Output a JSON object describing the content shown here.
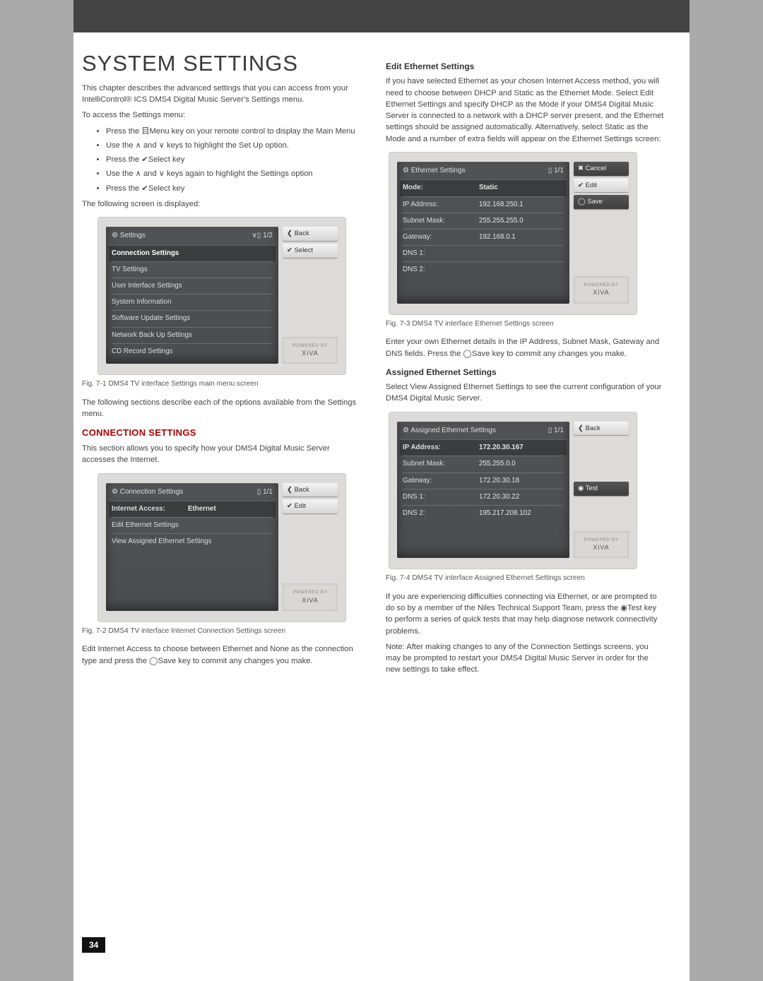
{
  "page": {
    "title": "SYSTEM SETTINGS",
    "intro": "This chapter describes the advanced settings that you can access from your IntelliControl® ICS DMS4 Digital Music Server's Settings menu.",
    "access_lead": "To access the Settings menu:",
    "steps": [
      "Press the 目Menu key on your remote control to display the Main Menu",
      "Use the ∧ and ∨ keys to highlight the Set Up option.",
      "Press the ✔Select key",
      "Use the ∧ and ∨ keys again to highlight the Settings option",
      "Press the ✔Select key"
    ],
    "post_steps": "The following screen is displayed:",
    "fig71_caption": "Fig. 7-1  DMS4 TV interface Settings main menu screen",
    "post_fig71": "The following sections describe each of the options available from the Settings menu.",
    "conn_heading": "CONNECTION SETTINGS",
    "conn_intro": "This section allows you to specify how your DMS4 Digital Music Server accesses the Internet.",
    "fig72_caption": "Fig. 7-2  DMS4 TV interface Internet Connection Settings screen",
    "conn_edit": "Edit Internet Access to choose between Ethernet and None as the connection type and press the ◯Save key to commit any changes you make.",
    "edit_eth_head": "Edit Ethernet Settings",
    "edit_eth_body": "If you have selected Ethernet as your chosen Internet Access method, you will need to choose between DHCP and Static as the Ethernet Mode.  Select Edit Ethernet Settings and specify DHCP as the Mode if your DMS4 Digital Music Server is connected to a network with a DHCP server present, and the Ethernet settings should be assigned automatically.  Alternatively, select Static as the Mode and a number of extra fields will appear on the Ethernet Settings screen:",
    "fig73_caption": "Fig. 7-3  DMS4 TV interface Ethernet Settings screen",
    "post_fig73": "Enter your own Ethernet details in the IP Address, Subnet Mask, Gateway and DNS fields.  Press the ◯Save key to commit any changes you make.",
    "assigned_head": "Assigned Ethernet Settings",
    "assigned_lead": "Select View Assigned Ethernet Settings to see the current configuration of your DMS4 Digital Music Server.",
    "fig74_caption": "Fig. 7-4  DMS4 TV interface Assigned Ethernet Settings screen",
    "post_fig74": "If you are experiencing difficulties connecting via Ethernet, or are prompted to do so by a member of the Niles Technical Support Team, press the ◉Test key to perform a series of quick tests that may help diagnose network connectivity problems.",
    "note": "Note: After making changes to any of the Connection Settings screens, you may be prompted to restart your DMS4 Digital Music Server in order for the new settings to take effect.",
    "page_number": "34"
  },
  "fig71": {
    "title": "Settings",
    "counter": "∨▯ 1/2",
    "rows": [
      "Connection Settings",
      "TV Settings",
      "User Interface Settings",
      "System Information",
      "Software Update Settings",
      "Network Back Up Settings",
      "CD Record Settings"
    ],
    "btn_back": "❮  Back",
    "btn_select": "✔  Select",
    "brand_small": "POWERED BY",
    "brand": "XiVA"
  },
  "fig72": {
    "title": "Connection Settings",
    "counter": "▯ 1/1",
    "rows": [
      {
        "label": "Internet Access:",
        "value": "Ethernet",
        "sel": true
      },
      {
        "label": "Edit Ethernet Settings",
        "value": "",
        "sel": false
      },
      {
        "label": "View Assigned Ethernet Settings",
        "value": "",
        "sel": false
      }
    ],
    "btn_back": "❮  Back",
    "btn_edit": "✔  Edit",
    "brand_small": "POWERED BY",
    "brand": "XiVA"
  },
  "fig73": {
    "title": "Ethernet Settings",
    "counter": "▯ 1/1",
    "rows": [
      {
        "label": "Mode:",
        "value": "Static",
        "sel": true
      },
      {
        "label": "IP Address:",
        "value": "192.168.250.1"
      },
      {
        "label": "Subnet Mask:",
        "value": "255.255.255.0"
      },
      {
        "label": "Gateway:",
        "value": "192.168.0.1"
      },
      {
        "label": "DNS 1:",
        "value": ""
      },
      {
        "label": "DNS 2:",
        "value": ""
      }
    ],
    "btn_cancel": "✖  Cancel",
    "btn_edit": "✔  Edit",
    "btn_save": "◯  Save",
    "brand_small": "POWERED BY",
    "brand": "XiVA"
  },
  "fig74": {
    "title": "Assigned Ethernet Settings",
    "counter": "▯ 1/1",
    "rows": [
      {
        "label": "IP Address:",
        "value": "172.20.30.167",
        "sel": true
      },
      {
        "label": "Subnet Mask:",
        "value": "255.255.0.0"
      },
      {
        "label": "Gateway:",
        "value": "172.20.30.18"
      },
      {
        "label": "DNS 1:",
        "value": "172.20.30.22"
      },
      {
        "label": "DNS 2:",
        "value": "195.217.208.102"
      }
    ],
    "btn_back": "❮  Back",
    "btn_test": "◉  Test",
    "brand_small": "POWERED BY",
    "brand": "XiVA"
  }
}
